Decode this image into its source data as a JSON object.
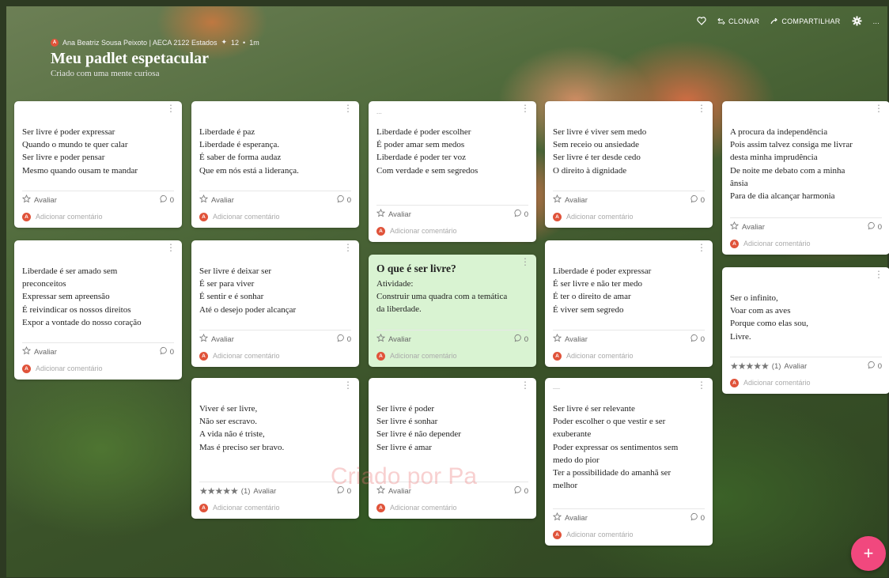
{
  "topbar": {
    "clone_label": "CLONAR",
    "share_label": "COMPARTILHAR",
    "more_label": "..."
  },
  "header": {
    "avatar_letter": "A",
    "author": "Ana Beatriz Sousa Peixoto | AECA 2122 Estados",
    "likes": "12",
    "time": "1m",
    "title": "Meu padlet espetacular",
    "subtitle": "Criado com uma mente curiosa"
  },
  "labels": {
    "rate": "Avaliar",
    "add_comment": "Adicionar comentário",
    "avatar_letter": "A"
  },
  "cards": [
    {
      "lines": [
        "Ser livre é poder expressar",
        "Quando o mundo te quer calar",
        "Ser livre e poder pensar",
        "Mesmo quando ousam te mandar"
      ],
      "comments": "0"
    },
    {
      "lines": [
        "Liberdade é paz",
        "Liberdade é esperança.",
        "É saber de forma audaz",
        "Que em nós está a liderança."
      ],
      "comments": "0"
    },
    {
      "tiny": "...",
      "lines": [
        "Liberdade é poder escolher",
        "É poder amar sem medos",
        "Liberdade é poder ter voz",
        "Com verdade e sem segredos"
      ],
      "comments": "0"
    },
    {
      "lines": [
        "Ser livre é viver sem medo",
        "Sem receio ou ansiedade",
        "Ser livre é ter desde cedo",
        "O direito à dignidade"
      ],
      "comments": "0"
    },
    {
      "lines": [
        "A procura da independência",
        "Pois assim talvez consiga me livrar",
        "desta minha imprudência",
        "De noite me debato com a minha",
        "ânsia",
        "Para de dia alcançar harmonia"
      ],
      "comments": "0"
    },
    {
      "lines": [
        "Liberdade é ser amado sem",
        "preconceitos",
        "Expressar sem apreensão",
        "É reivindicar os nossos direitos",
        "Expor a vontade do nosso coração"
      ],
      "comments": "0"
    },
    {
      "lines": [
        "Ser livre é deixar ser",
        "É ser para viver",
        "É sentir e é sonhar",
        "Até o desejo poder alcançar"
      ],
      "comments": "0"
    },
    {
      "title": "O que é ser livre?",
      "lines": [
        "Atividade:",
        "Construir uma quadra com a temática",
        "da liberdade."
      ],
      "comments": "0"
    },
    {
      "lines": [
        "Liberdade é poder expressar",
        "É ser livre e não ter medo",
        "É ter o direito de amar",
        "É viver sem segredo"
      ],
      "comments": "0"
    },
    {
      "lines": [
        "Ser o infinito,",
        "Voar com as aves",
        "Porque como elas sou,",
        "Livre."
      ],
      "stars": "★★★★★",
      "rating_count": "(1)",
      "comments": "0"
    },
    {
      "lines": [
        "Viver é ser livre,",
        "Não ser escravo.",
        "A vida não é triste,",
        "Mas é preciso ser bravo."
      ],
      "stars": "★★★★★",
      "rating_count": "(1)",
      "comments": "0"
    },
    {
      "lines": [
        "Ser livre é poder",
        "Ser livre é sonhar",
        "Ser livre é não depender",
        "Ser livre é amar"
      ],
      "comments": "0"
    },
    {
      "tiny": "—",
      "lines": [
        "Ser livre é ser relevante",
        "Poder escolher o que vestir e ser",
        "exuberante",
        "Poder expressar os sentimentos sem",
        "medo do pior",
        "Ter a possibilidade do amanhã ser",
        "melhor"
      ],
      "comments": "0"
    }
  ],
  "watermark": "Criado por Pa",
  "fab_label": "+"
}
